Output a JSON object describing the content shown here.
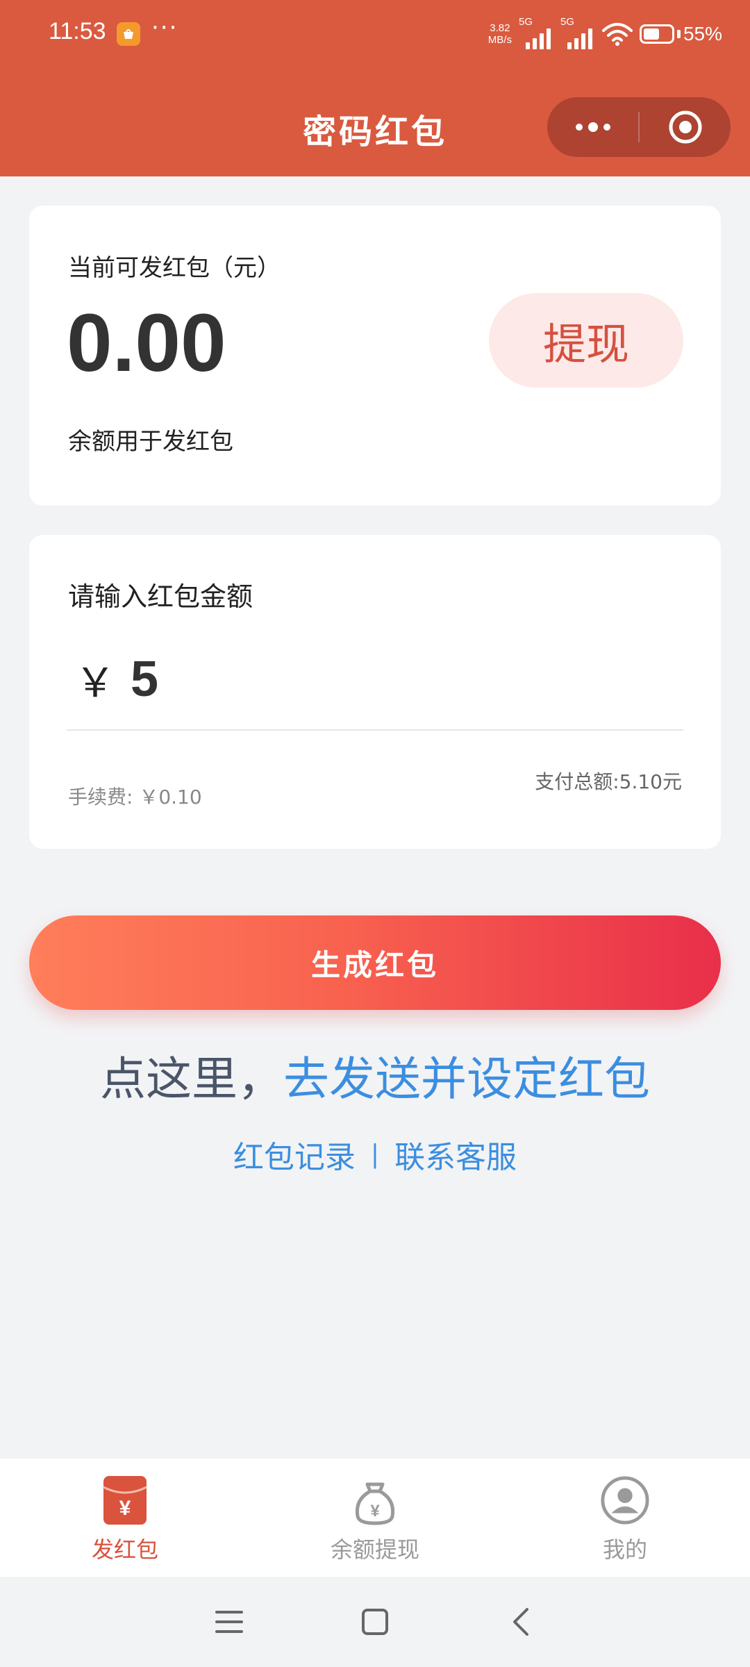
{
  "status_bar": {
    "time": "11:53",
    "more": "···",
    "net_speed_value": "3.82",
    "net_speed_unit": "MB/s",
    "signal1_label": "5G",
    "signal2_label": "5G",
    "battery_pct": "55%"
  },
  "header": {
    "title": "密码红包"
  },
  "balance_card": {
    "label": "当前可发红包（元）",
    "value": "0.00",
    "note": "余额用于发红包",
    "withdraw_label": "提现"
  },
  "amount_card": {
    "label": "请输入红包金额",
    "currency": "￥",
    "amount_value": "5",
    "fee_text": "手续费: ￥0.10",
    "total_text": "支付总额:5.10元"
  },
  "actions": {
    "generate_label": "生成红包",
    "promo_prefix": "点这里，",
    "promo_link": "去发送并设定红包",
    "records_link": "红包记录",
    "separator": "|",
    "service_link": "联系客服"
  },
  "tab_bar": {
    "tabs": [
      {
        "label": "发红包",
        "icon": "red-envelope-icon",
        "active": true
      },
      {
        "label": "余额提现",
        "icon": "money-bag-icon",
        "active": false
      },
      {
        "label": "我的",
        "icon": "user-profile-icon",
        "active": false
      }
    ]
  },
  "colors": {
    "header_bg": "#d95a3f",
    "accent": "#d9533d",
    "link": "#3b8ee0",
    "button_gradient_start": "#ff7e5b",
    "button_gradient_end": "#e92f4a"
  }
}
